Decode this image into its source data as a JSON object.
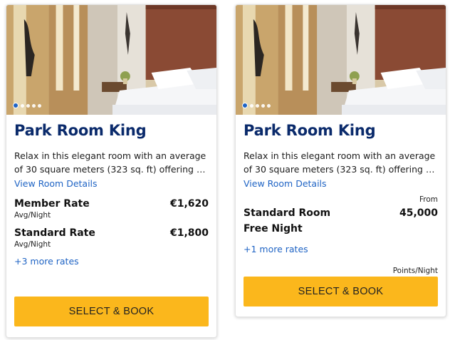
{
  "cards": [
    {
      "title": "Park Room King",
      "description": "Relax in this elegant room with an average of 30 square meters (323 sq. ft) offering a refined, contemporary design.",
      "view_details": "View Room Details",
      "rates": [
        {
          "name": "Member Rate",
          "price": "€1,620",
          "unit": "Avg/Night"
        },
        {
          "name": "Standard Rate",
          "price": "€1,800",
          "unit": "Avg/Night"
        }
      ],
      "more_rates": "+3 more rates",
      "button": "SELECT & BOOK",
      "carousel": {
        "total": 5,
        "active": 1
      }
    },
    {
      "title": "Park Room King",
      "description": "Relax in this elegant room with an average of 30 square meters (323 sq. ft) offering a refined, contemporary design.",
      "view_details": "View Room Details",
      "from_label": "From",
      "rate": {
        "name": "Standard Room Free Night",
        "points": "45,000"
      },
      "more_rates": "+1 more rates",
      "points_unit": "Points/Night",
      "button": "SELECT & BOOK",
      "carousel": {
        "total": 5,
        "active": 1
      }
    }
  ],
  "colors": {
    "title": "#0a2a6b",
    "link": "#1e63c4",
    "button": "#fbb71c"
  }
}
